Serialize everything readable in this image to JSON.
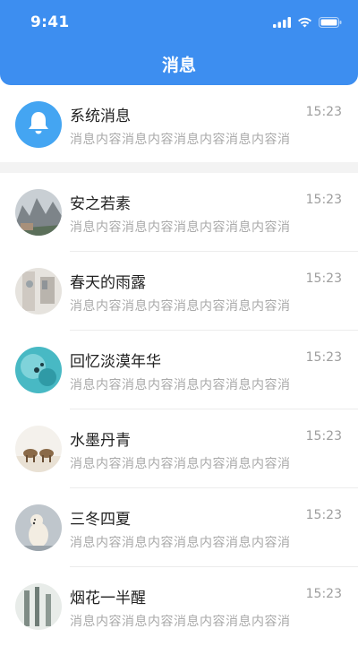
{
  "status_bar": {
    "time": "9:41"
  },
  "header": {
    "title": "消息"
  },
  "system_message": {
    "name": "系统消息",
    "preview": "消息内容消息内容消息内容消息内容消息内容",
    "time": "15:23"
  },
  "conversations": [
    {
      "name": "安之若素",
      "preview": "消息内容消息内容消息内容消息内容消息内容",
      "time": "15:23"
    },
    {
      "name": "春天的雨露",
      "preview": "消息内容消息内容消息内容消息内容消息内容",
      "time": "15:23"
    },
    {
      "name": "回忆淡漠年华",
      "preview": "消息内容消息内容消息内容消息内容消息内容",
      "time": "15:23"
    },
    {
      "name": "水墨丹青",
      "preview": "消息内容消息内容消息内容消息内容消息内容",
      "time": "15:23"
    },
    {
      "name": "三冬四夏",
      "preview": "消息内容消息内容消息内容消息内容消息内容",
      "time": "15:23"
    },
    {
      "name": "烟花一半醒",
      "preview": "消息内容消息内容消息内容消息内容消息内容",
      "time": "15:23"
    }
  ],
  "colors": {
    "accent": "#3d8ef0",
    "system_icon_bg": "#44a5f2"
  }
}
